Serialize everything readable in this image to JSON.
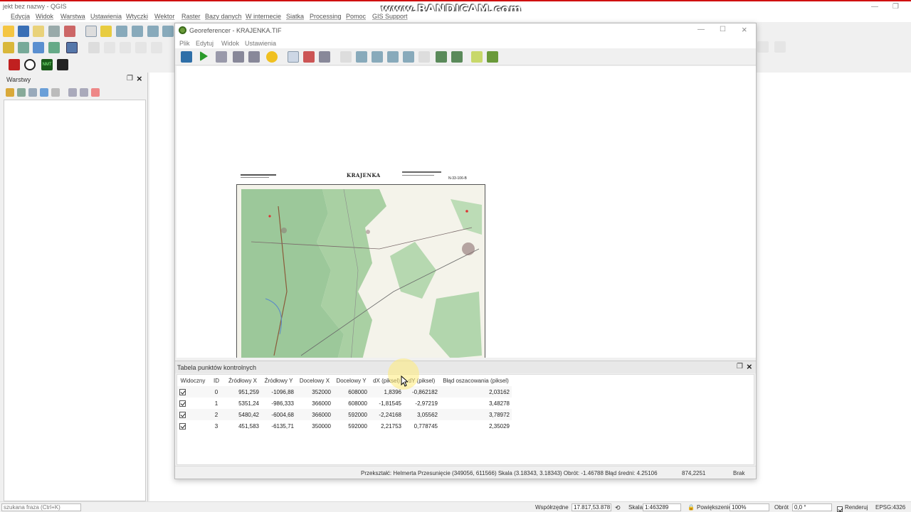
{
  "main": {
    "title": "jekt bez nazwy - QGIS",
    "menu": [
      "Edycja",
      "Widok",
      "Warstwa",
      "Ustawienia",
      "Wtyczki",
      "Wektor",
      "Raster",
      "Bazy danych",
      "W internecie",
      "Siatka",
      "Processing",
      "Pomoc",
      "GIS Support"
    ],
    "watermark": "www.BANDICAM.com",
    "layers_panel_title": "Warstwy",
    "nmt_label": "NMT"
  },
  "statusbar": {
    "search_placeholder": "szukana fraza (Ctrl+K)",
    "coords_label": "Współrzędne",
    "coords_value": "17.817,53.878",
    "scale_label": "Skala",
    "scale_value": "1:463289",
    "magnifier_label": "Powiększenie",
    "magnifier_value": "100%",
    "rotation_label": "Obrót",
    "rotation_value": "0,0 °",
    "render_label": "Renderuj",
    "crs_label": "EPSG:4326"
  },
  "geo": {
    "title": "Georeferencer - KRAJENKA.TIF",
    "menu": [
      "Plik",
      "Edytuj",
      "Widok",
      "Ustawienia"
    ],
    "map_title": "KRAJENKA",
    "map_sheet": "N-33-106-B",
    "gcp_title": "Tabela punktów kontrolnych",
    "columns": [
      "Widoczny",
      "ID",
      "Źródłowy X",
      "Źródłowy Y",
      "Docelowy X",
      "Docelowy Y",
      "dX (piksel)",
      "dY (piksel)",
      "Błąd oszacowania (piksel)"
    ],
    "rows": [
      {
        "id": "0",
        "srcx": "951,259",
        "srcy": "-1096,88",
        "dstx": "352000",
        "dsty": "608000",
        "dx": "1,8396",
        "dy": "-0,862182",
        "err": "2,03162"
      },
      {
        "id": "1",
        "srcx": "5351,24",
        "srcy": "-986,333",
        "dstx": "366000",
        "dsty": "608000",
        "dx": "-1,81545",
        "dy": "-2,97219",
        "err": "3,48278"
      },
      {
        "id": "2",
        "srcx": "5480,42",
        "srcy": "-6004,68",
        "dstx": "366000",
        "dsty": "592000",
        "dx": "-2,24168",
        "dy": "3,05562",
        "err": "3,78972"
      },
      {
        "id": "3",
        "srcx": "451,583",
        "srcy": "-6135,71",
        "dstx": "350000",
        "dsty": "592000",
        "dx": "2,21753",
        "dy": "0,778745",
        "err": "2,35029"
      }
    ],
    "status_transform": "Przekształć: Helmerta Przesunięcie (349056, 611566) Skala (3.18343, 3.18343) Obrót: -1.46788 Błąd średni: 4.25106",
    "status_coords": "874,2251",
    "status_crs": "Brak"
  }
}
